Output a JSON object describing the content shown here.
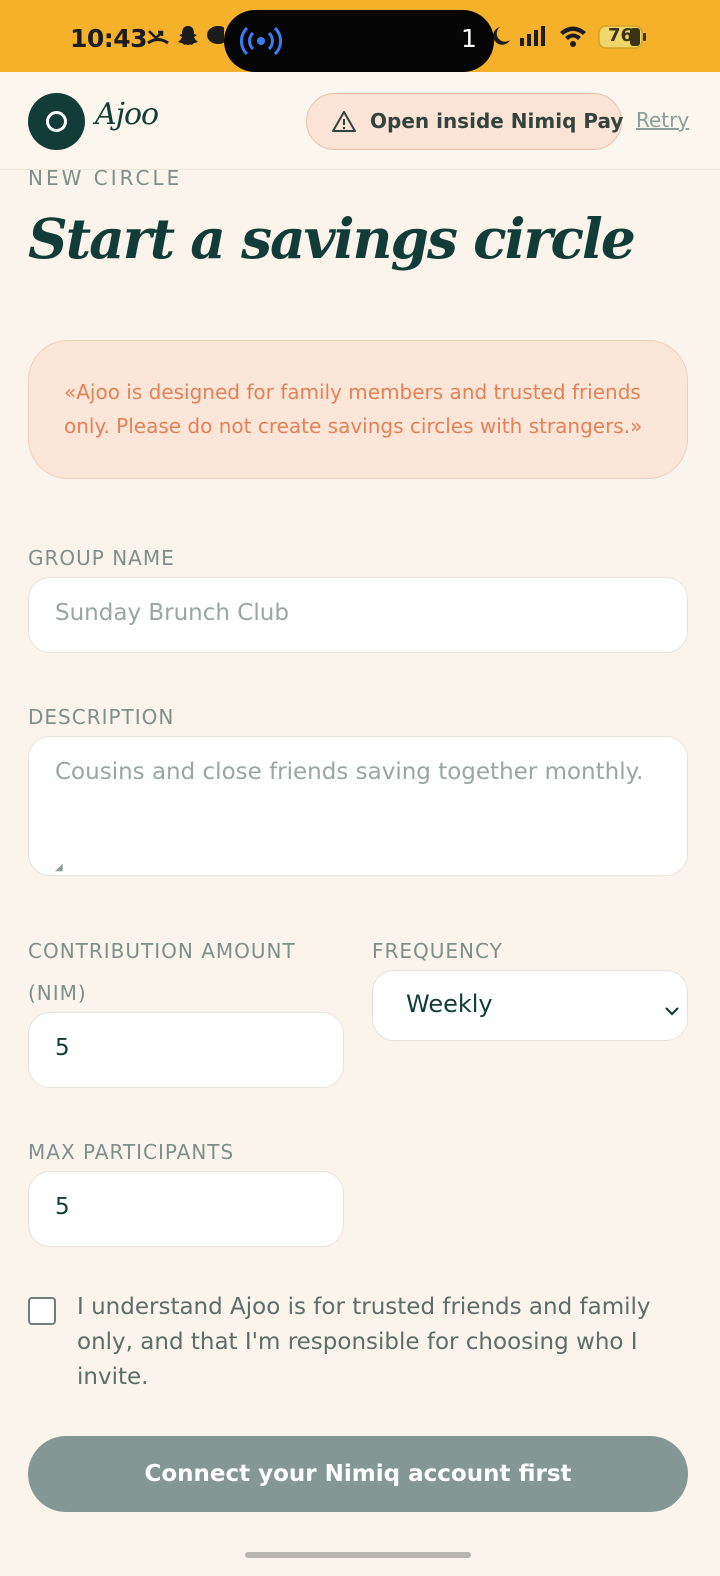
{
  "status_bar": {
    "time": "10:43",
    "island_count": "1",
    "battery": "76",
    "icons": [
      "missed-call-icon",
      "snapchat-icon",
      "chat-icon",
      "broadcast-icon",
      "moon-icon",
      "signal-icon",
      "wifi-icon",
      "battery-icon"
    ]
  },
  "header": {
    "brand": "Ajoo",
    "open_nimiq": "Open inside Nimiq Pay",
    "retry": "Retry"
  },
  "page": {
    "kicker": "NEW CIRCLE",
    "title": "Start a savings circle"
  },
  "notice": {
    "text": "«Ajoo is designed for family members and trusted friends only. Please do not create savings circles with strangers.»"
  },
  "form": {
    "group_name_label": "GROUP NAME",
    "group_name_placeholder": "Sunday Brunch Club",
    "description_label": "DESCRIPTION",
    "description_placeholder": "Cousins and close friends saving together monthly.",
    "contribution_label": "CONTRIBUTION AMOUNT (NIM)",
    "contribution_value": "5",
    "frequency_label": "FREQUENCY",
    "frequency_value": "Weekly",
    "max_participants_label": "MAX PARTICIPANTS",
    "max_participants_value": "5",
    "consent_text": "I understand Ajoo is for trusted friends and family only, and that I'm responsible for choosing who I invite.",
    "submit_label": "Connect your Nimiq account first"
  },
  "colors": {
    "status_bar": "#f6b12a",
    "brand_dark": "#123c38",
    "notice_text": "#e3825a",
    "button_disabled": "#859794"
  }
}
